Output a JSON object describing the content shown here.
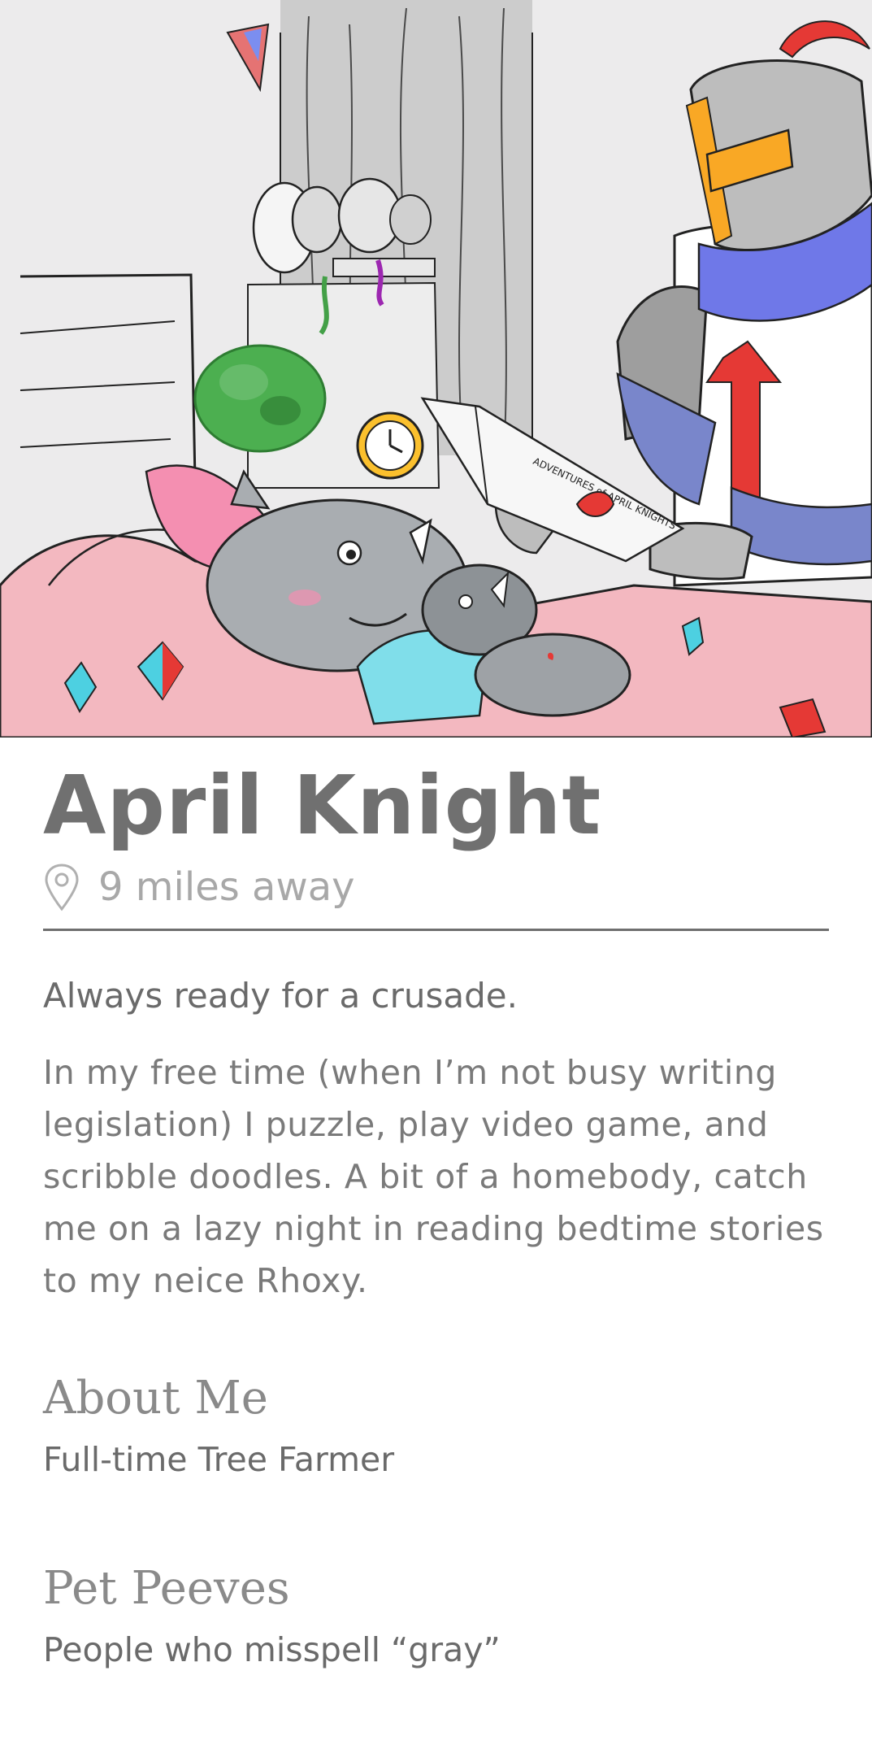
{
  "profile": {
    "name": "April Knight",
    "distance": "9 miles away",
    "tagline": "Always ready for a crusade.",
    "bio": "In my free time (when I’m not busy writing legislation) I puzzle, play video game, and scribble doodles. A bit of a homebody, catch me on a lazy night in reading bedtime stories to my neice Rhoxy."
  },
  "sections": [
    {
      "title": "About Me",
      "body": "Full-time Tree Farmer"
    },
    {
      "title": "Pet Peeves",
      "body": "People who misspell “gray”"
    }
  ],
  "hero": {
    "book_title": "ADVENTURES of APRIL KNIGHTS"
  },
  "icons": {
    "location": "map-pin-icon"
  },
  "colors": {
    "text_primary": "#707070",
    "text_muted": "#a8a8a8",
    "divider": "#6f6f6f",
    "knight_scarf": "#6f78e8",
    "knight_plume": "#e53935"
  }
}
